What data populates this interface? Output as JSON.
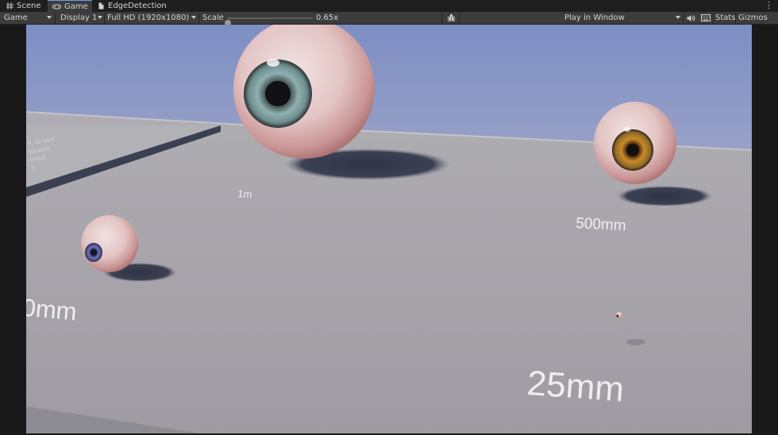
{
  "tabs": [
    {
      "label": "Scene",
      "icon": "hash-grid-icon",
      "active": false
    },
    {
      "label": "Game",
      "icon": "gamepad-icon",
      "active": true
    },
    {
      "label": "EdgeDetection",
      "icon": "document-icon",
      "active": false
    }
  ],
  "toolbar": {
    "view_mode": "Game",
    "display": "Display 1",
    "resolution": "Full HD (1920x1080)",
    "scale_label": "Scale",
    "scale_value": "0.65x",
    "scale_fraction": 0.0,
    "play_mode": "Play in Window",
    "stats_label": "Stats",
    "gizmos_label": "Gizmos"
  },
  "scene": {
    "labels": [
      "1m",
      "500mm",
      "0mm",
      "25mm"
    ],
    "faded_text": [
      "n, to use",
      "sewed",
      "oned",
      "s"
    ],
    "eye_colors": {
      "iris_gray": "#6f8d8f",
      "iris_amber": "#b77b1e",
      "iris_blue": "#5a5fa8"
    },
    "sky_color": "#8e9ac7",
    "floor_color": "#a6a3a8"
  }
}
